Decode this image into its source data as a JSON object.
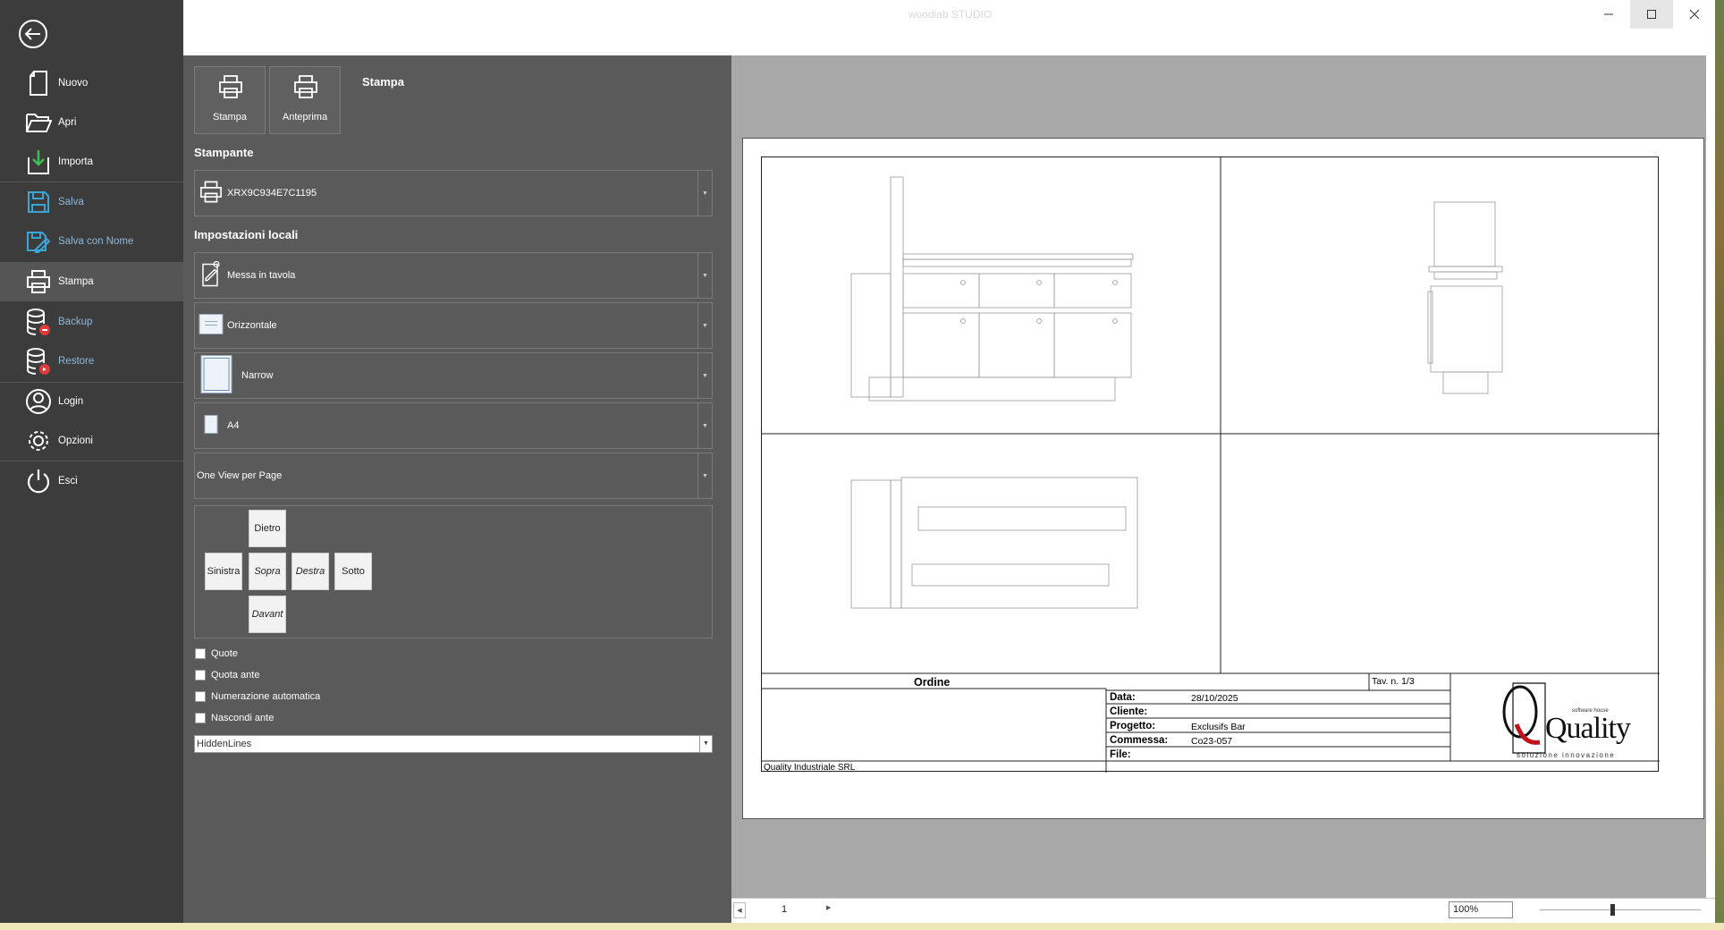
{
  "window": {
    "title": "woodlab STUDIO"
  },
  "sidebar": {
    "items": [
      {
        "label": "Nuovo",
        "icon": "new-file-icon"
      },
      {
        "label": "Apri",
        "icon": "folder-open-icon"
      },
      {
        "label": "Importa",
        "icon": "import-icon"
      },
      {
        "label": "Salva",
        "icon": "save-icon"
      },
      {
        "label": "Salva con Nome",
        "icon": "save-as-icon"
      },
      {
        "label": "Stampa",
        "icon": "printer-icon"
      },
      {
        "label": "Backup",
        "icon": "database-backup-icon"
      },
      {
        "label": "Restore",
        "icon": "database-restore-icon"
      },
      {
        "label": "Login",
        "icon": "user-icon"
      },
      {
        "label": "Opzioni",
        "icon": "gear-icon"
      },
      {
        "label": "Esci",
        "icon": "power-icon"
      }
    ]
  },
  "panel": {
    "buttons": {
      "print": "Stampa",
      "preview": "Anteprima"
    },
    "title": "Stampa",
    "printer_header": "Stampante",
    "printer": "XRX9C934E7C1195",
    "local_header": "Impostazioni locali",
    "layout": "Messa in tavola",
    "orientation": "Orizzontale",
    "margins": "Narrow",
    "paper": "A4",
    "views_per_page": "One View per Page",
    "views": {
      "back": "Dietro",
      "left": "Sinistra",
      "top": "Sopra",
      "right": "Destra",
      "bottom": "Sotto",
      "front": "Davant"
    },
    "checks": [
      "Quote",
      "Quota ante",
      "Numerazione automatica",
      "Nascondi ante"
    ],
    "hidden_lines": "HiddenLines"
  },
  "titleblock": {
    "ordine": "Ordine",
    "tav": "Tav. n. 1/3",
    "data_label": "Data:",
    "data": "28/10/2025",
    "cliente_label": "Cliente:",
    "progetto_label": "Progetto:",
    "progetto": "Exclusifs Bar",
    "commessa_label": "Commessa:",
    "commessa": "Co23-057",
    "file_label": "File:",
    "company": "Quality Industriale SRL",
    "logo_text": "Quality",
    "logo_sub": "software house",
    "logo_tag": "soluzione innovazione"
  },
  "status": {
    "page": "1",
    "zoom": "100%",
    "zoom_level": 0.45
  },
  "colors": {
    "sidebar": "#3c3c3c",
    "panel": "#5a5a5a",
    "preview_bg": "#a8a8a8",
    "logo_red": "#c0141c"
  }
}
